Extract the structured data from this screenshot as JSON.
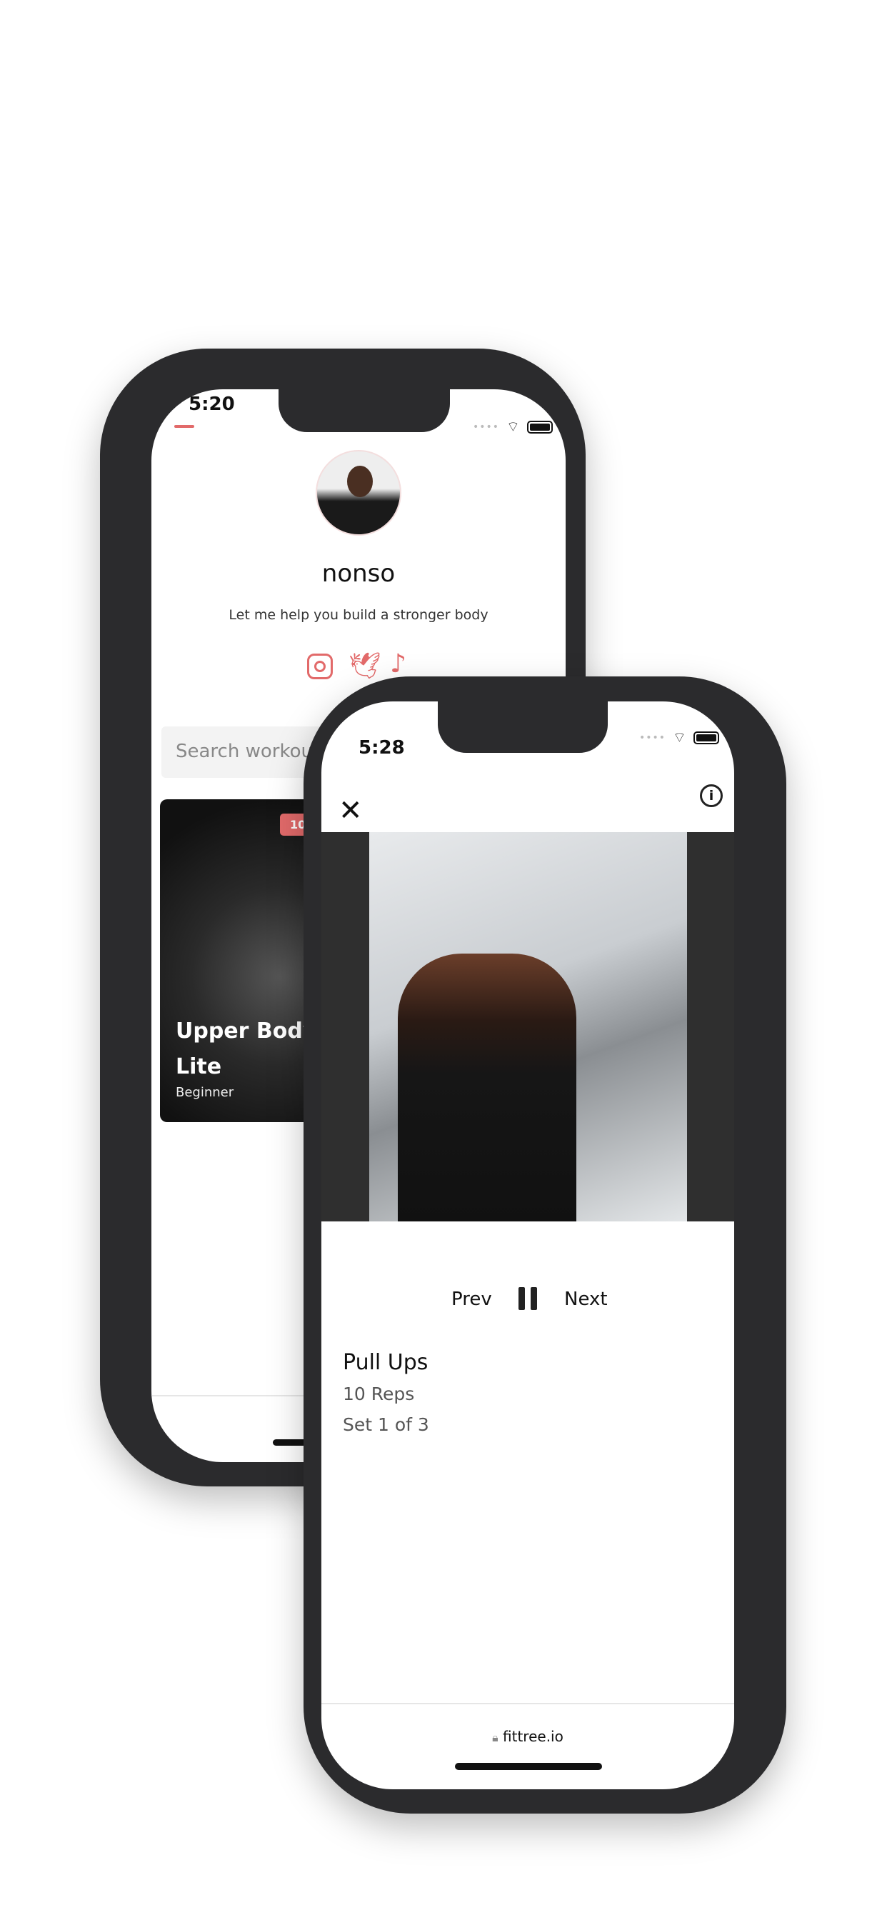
{
  "back_phone": {
    "status_time": "5:20",
    "profile": {
      "name": "nonso",
      "bio": "Let me help you build a stronger body"
    },
    "social_icons": [
      "instagram-icon",
      "twitter-icon",
      "tiktok-icon"
    ],
    "search": {
      "placeholder": "Search workouts"
    },
    "workout_card": {
      "badge": "10",
      "title": "Upper Body: Lite",
      "level": "Beginner"
    },
    "accent_color": "#e26a6a"
  },
  "front_phone": {
    "status_time": "5:28",
    "controls": {
      "prev": "Prev",
      "next": "Next"
    },
    "exercise": {
      "name": "Pull Ups",
      "reps": "10 Reps",
      "set": "Set 1 of 3"
    },
    "url": "fittree.io"
  }
}
